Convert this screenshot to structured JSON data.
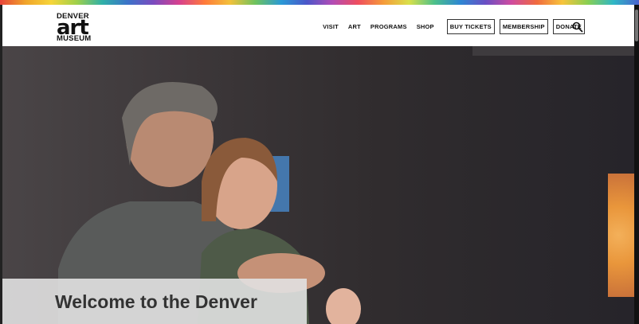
{
  "logo": {
    "line1": "DENVER",
    "line2": "art",
    "line3": "MUSEUM"
  },
  "nav": {
    "links": [
      "VISIT",
      "ART",
      "PROGRAMS",
      "SHOP"
    ],
    "buttons": [
      "BUY TICKETS",
      "MEMBERSHIP",
      "DONATE"
    ],
    "search_icon": "search-icon"
  },
  "hero": {
    "title": "Welcome to the Denver"
  },
  "colors": {
    "header_bg": "#ffffff",
    "text": "#111111",
    "caption_bg": "#e1e1e1"
  }
}
